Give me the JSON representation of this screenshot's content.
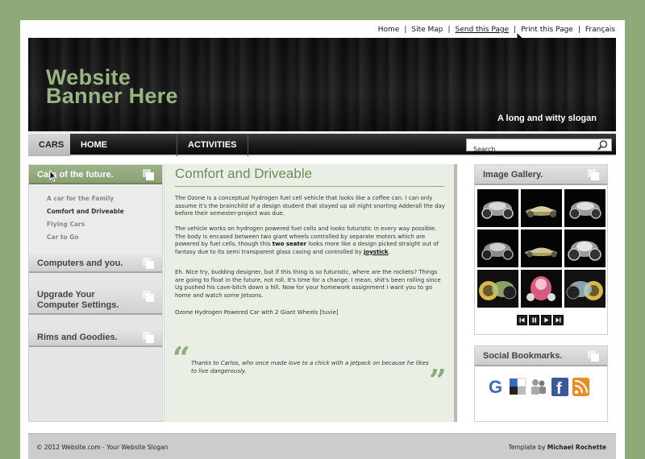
{
  "top_links": [
    "Home",
    "Site Map",
    "Send this Page",
    "Print this Page",
    "Français"
  ],
  "banner": {
    "title_line1": "Website",
    "title_line2": "Banner Here",
    "slogan": "A long and witty slogan"
  },
  "nav": {
    "items": [
      "CARS",
      "HOME IMPROVEMENT",
      "ACTIVITIES"
    ],
    "search_value": "Search"
  },
  "sidebar": {
    "section1": "Cars of the future.",
    "sub_items": [
      "A car for the Family",
      "Comfort and Driveable",
      "Flying Cars",
      "Car to Go"
    ],
    "section2": "Computers and you.",
    "section3_line1": "Upgrade Your",
    "section3_line2": "Computer Settings.",
    "section4": "Rims and Goodies."
  },
  "main": {
    "title": "Comfort and Driveable",
    "p1": "The Ozone is a conceptual hydrogen fuel cell vehicle that looks like a coffee can. I can only assume it's the brainchild of a design student that stayed up all night snorting Adderall the day before their semester-project was due.",
    "p2_a": "The vehicle works on hydrogen powered fuel cells and looks futuristic in every way possible. The body is encased between two giant wheels controlled by separate motors which are powered by fuel cells, though this ",
    "p2_bold": "two seater",
    "p2_b": " looks more like a design picked straight out of fantasy due to its semi transparent glass casing and controlled by ",
    "p2_link": "joystick",
    "p2_end": ".",
    "p3": "Eh. Nice try, budding designer, but if this thing is so futuristic, where are the rockets? Things are going to float in the future, not roll. It's time for a change. I mean, shit's been rolling since Ug pushed his cave-bitch down a hill. Now for your homework assignment I want you to go home and watch some Jetsons.",
    "p4": "Ozone Hydrogen Powered Car with 2 Giant Wheels [tuvie]",
    "quote_open": "“",
    "quote": "Thanks to Carlos, who once made love to a chick with a jetpack on because he likes to live dangerously.",
    "quote_close": "”"
  },
  "right": {
    "gallery_title": "Image Gallery.",
    "social_title": "Social Bookmarks."
  },
  "footer": {
    "copyright": "© 2012 Website.com - Your Website Slogan",
    "credit_prefix": "Template by ",
    "credit_name": "Michael Rochette"
  },
  "colors": {
    "background": "#8fa979",
    "accent": "#9db389",
    "title_green": "#6f8c56"
  }
}
